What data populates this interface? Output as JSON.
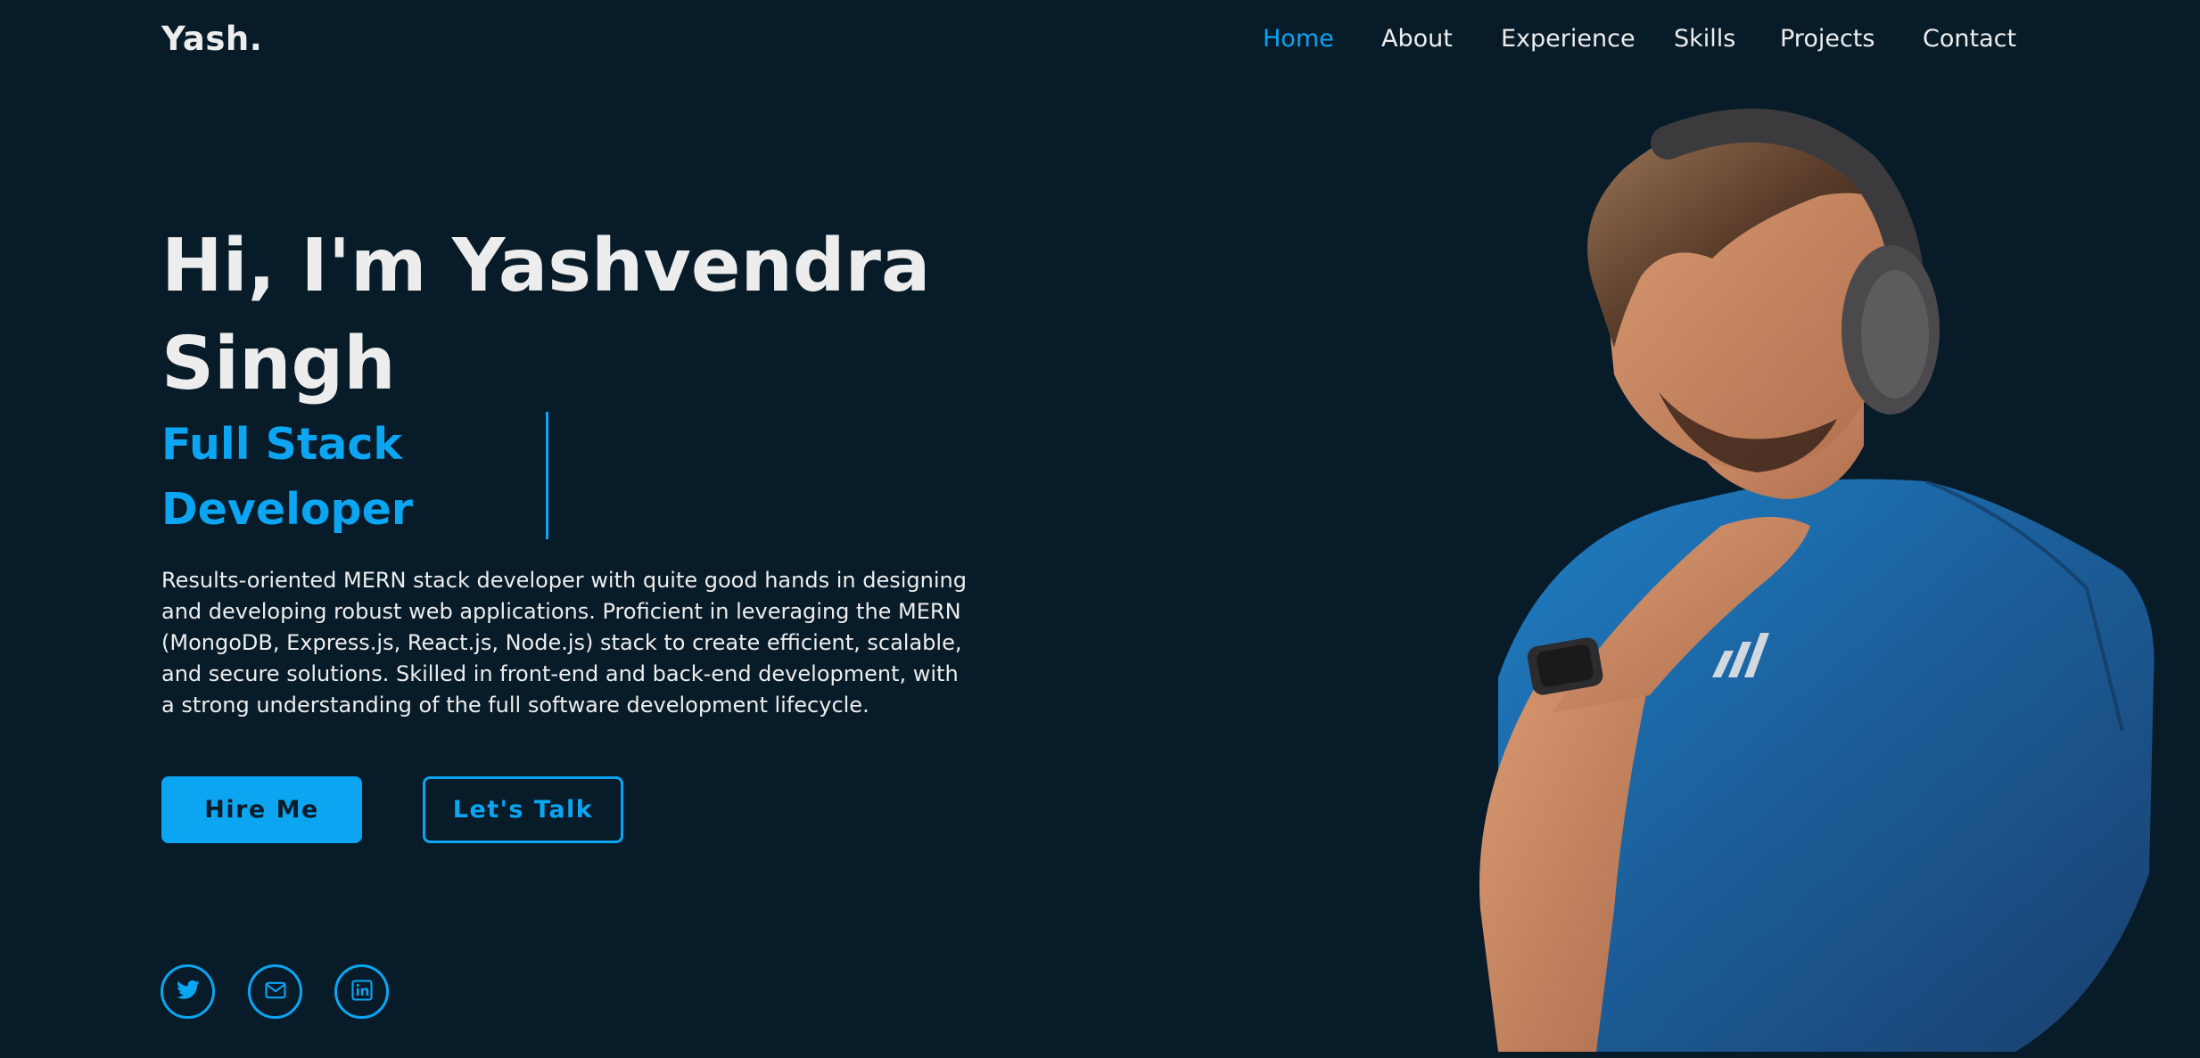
{
  "header": {
    "logo": "Yash.",
    "nav": [
      {
        "label": "Home",
        "active": true
      },
      {
        "label": "About",
        "active": false
      },
      {
        "label": "Experience",
        "active": false
      },
      {
        "label": "Skills",
        "active": false
      },
      {
        "label": "Projects",
        "active": false
      },
      {
        "label": "Contact",
        "active": false
      }
    ]
  },
  "hero": {
    "title": "Hi, I'm Yashvendra Singh",
    "role": "Full Stack Developer",
    "description": "Results-oriented MERN stack developer with quite good hands in designing and developing robust web applications. Proficient in leveraging the MERN (MongoDB, Express.js, React.js, Node.js) stack to create efficient, scalable, and secure solutions. Skilled in front-end and back-end development, with a strong understanding of the full software development lifecycle.",
    "buttons": {
      "hire": "Hire Me",
      "talk": "Let's Talk"
    }
  },
  "social": [
    {
      "icon": "twitter-icon"
    },
    {
      "icon": "mail-icon"
    },
    {
      "icon": "linkedin-icon"
    }
  ],
  "colors": {
    "background": "#081b29",
    "accent": "#0ba5f2",
    "text": "#ededed"
  }
}
